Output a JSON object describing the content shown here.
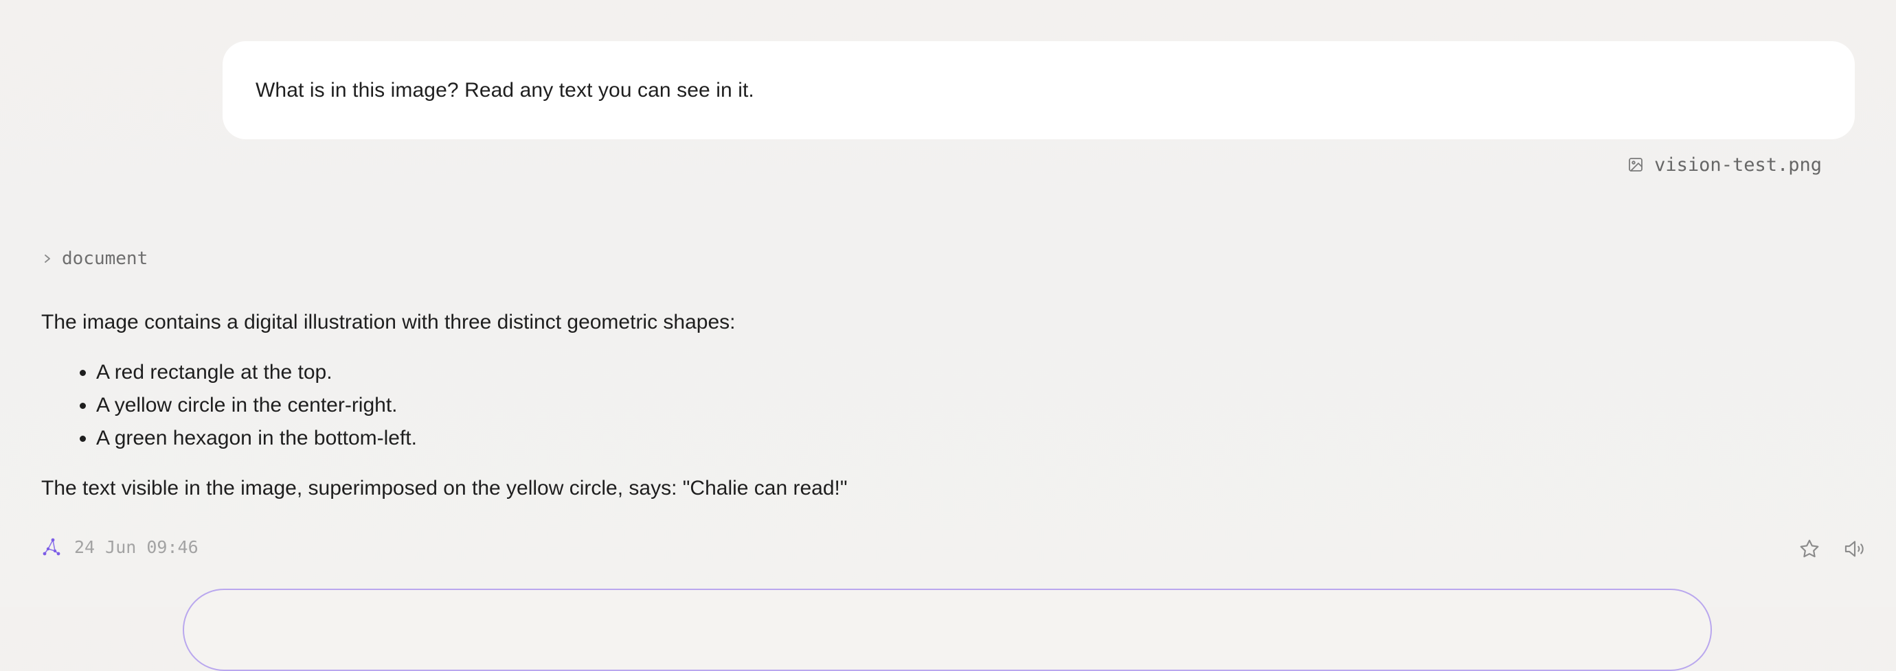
{
  "user_message": {
    "text": "What is in this image? Read any text you can see in it.",
    "attachment": {
      "icon": "image-icon",
      "filename": "vision-test.png"
    }
  },
  "document_toggle": {
    "icon": "chevron-right-icon",
    "label": "document"
  },
  "assistant_message": {
    "intro": "The image contains a digital illustration with three distinct geometric shapes:",
    "bullets": [
      "A red rectangle at the top.",
      "A yellow circle in the center-right.",
      "A green hexagon in the bottom-left."
    ],
    "conclusion": "The text visible in the image, superimposed on the yellow circle, says: \"Chalie can read!\""
  },
  "message_meta": {
    "model_icon": "constellation-icon",
    "timestamp": "24 Jun 09:46"
  },
  "message_actions": {
    "favorite_icon": "star-icon",
    "speak_icon": "speaker-icon"
  },
  "colors": {
    "background": "#f3f1ef",
    "bubble": "#ffffff",
    "text": "#1e1e1e",
    "muted": "#a3a3a3",
    "accent": "#7c5ce6",
    "composer_border": "#b9a7ee"
  }
}
